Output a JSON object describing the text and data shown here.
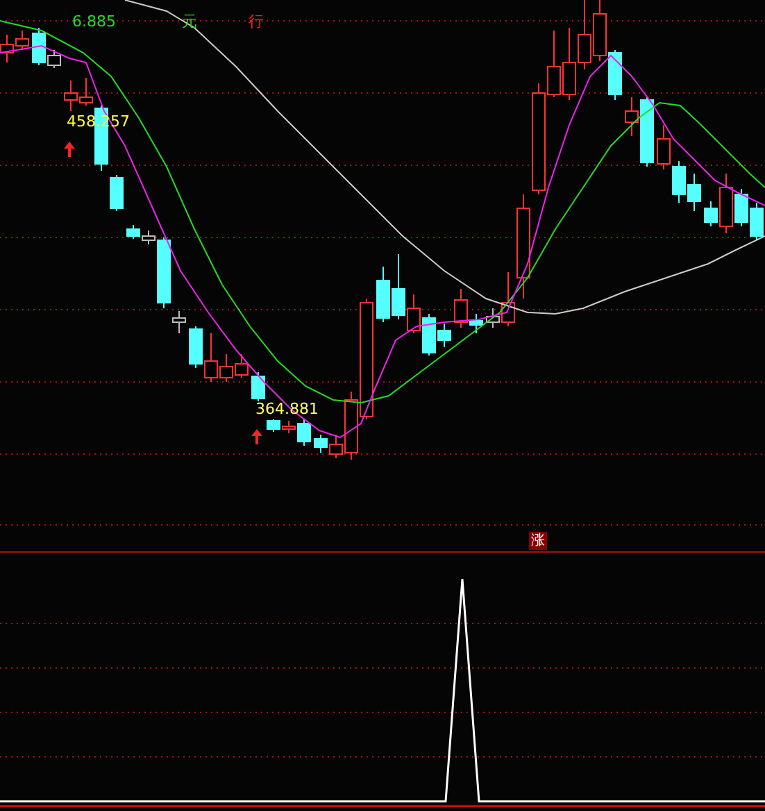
{
  "price_chart": {
    "header": [
      {
        "kind": "value",
        "text": "6.885"
      },
      {
        "kind": "unit",
        "text": "元"
      },
      {
        "kind": "label",
        "text": "行"
      }
    ],
    "markers": [
      {
        "text": "458.257",
        "kind": "high"
      },
      {
        "text": "364.881",
        "kind": "low"
      }
    ]
  },
  "signal_badge": {
    "text": "涨"
  }
}
